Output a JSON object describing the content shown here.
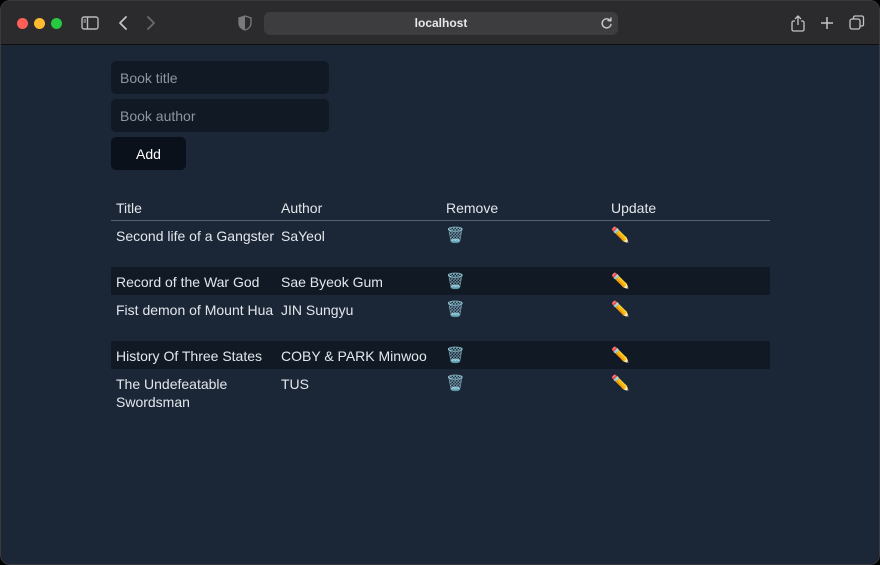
{
  "browser": {
    "url": "localhost"
  },
  "form": {
    "title_placeholder": "Book title",
    "author_placeholder": "Book author",
    "add_label": "Add"
  },
  "table": {
    "headers": [
      "Title",
      "Author",
      "Remove",
      "Update"
    ],
    "remove_icon": "🗑️",
    "update_icon": "✏️",
    "rows": [
      {
        "title": "Second life of a Gangster",
        "author": "SaYeol"
      },
      {
        "title": "Record of the War God",
        "author": "Sae Byeok Gum"
      },
      {
        "title": "Fist demon of Mount Hua",
        "author": "JIN Sungyu"
      },
      {
        "title": "History Of Three States",
        "author": "COBY & PARK Minwoo"
      },
      {
        "title": "The Undefeatable Swordsman",
        "author": "TUS"
      }
    ]
  }
}
